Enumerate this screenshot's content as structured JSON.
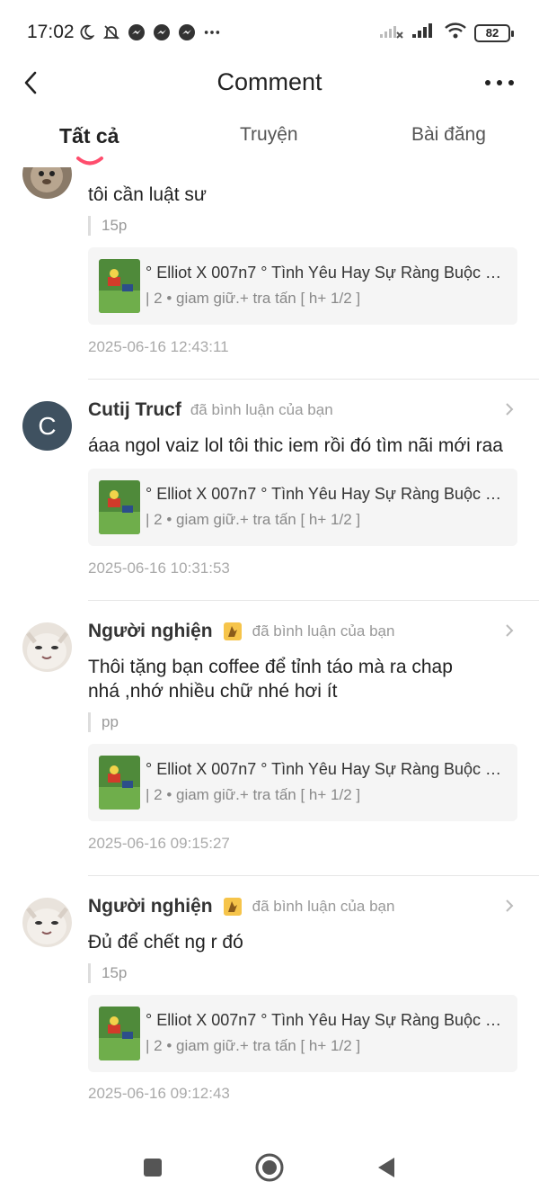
{
  "status_bar": {
    "time": "17:02",
    "battery": "82"
  },
  "header": {
    "title": "Comment"
  },
  "tabs": [
    {
      "label": "Tất cả"
    },
    {
      "label": "Truyện"
    },
    {
      "label": "Bài đăng"
    }
  ],
  "comments": [
    {
      "name": "",
      "action": "",
      "text": "tôi cần luật sư",
      "quote": "15p",
      "card": {
        "title": "° Elliot X 007n7 ° Tình Yêu Hay Sự Ràng Buộc ≧...",
        "subtitle": "| 2 • giam giữ.+ tra tấn [ h+ 1/2 ]"
      },
      "date": "2025-06-16 12:43:11"
    },
    {
      "name": "Cutij Trucf",
      "avatar_letter": "C",
      "action": "đã bình luận của bạn",
      "text": "áaa ngol vaiz lol tôi thic iem rồi đó tìm nãi mới raa",
      "card": {
        "title": "° Elliot X 007n7 ° Tình Yêu Hay Sự Ràng Buộc ≧...",
        "subtitle": "| 2 • giam giữ.+ tra tấn [ h+ 1/2 ]"
      },
      "date": "2025-06-16 10:31:53"
    },
    {
      "name": "Người nghiện",
      "action": "đã bình luận của bạn",
      "text_line1": "Thôi tặng bạn coffee để tỉnh táo mà ra chap",
      "text_line2": "nhá ,nhớ nhiều chữ nhé hơi ít",
      "quote": "pp",
      "card": {
        "title": "° Elliot X 007n7 ° Tình Yêu Hay Sự Ràng Buộc ≧...",
        "subtitle": "| 2 • giam giữ.+ tra tấn [ h+ 1/2 ]"
      },
      "date": "2025-06-16 09:15:27"
    },
    {
      "name": "Người nghiện",
      "action": "đã bình luận của bạn",
      "text": "Đủ để chết ng r đó",
      "quote": "15p",
      "card": {
        "title": "° Elliot X 007n7 ° Tình Yêu Hay Sự Ràng Buộc ≧...",
        "subtitle": "| 2 • giam giữ.+ tra tấn [ h+ 1/2 ]"
      },
      "date": "2025-06-16 09:12:43"
    }
  ],
  "colors": {
    "accent": "#ff4d6d",
    "avatar_bg": "#3f5160"
  },
  "icons": [
    "moon-icon",
    "bell-off-icon",
    "messenger-icon",
    "more-horizontal-icon",
    "signal-icon",
    "wifi-icon",
    "battery-icon",
    "back-icon",
    "chevron-right-icon",
    "stop-icon",
    "home-icon",
    "back-triangle-icon"
  ]
}
